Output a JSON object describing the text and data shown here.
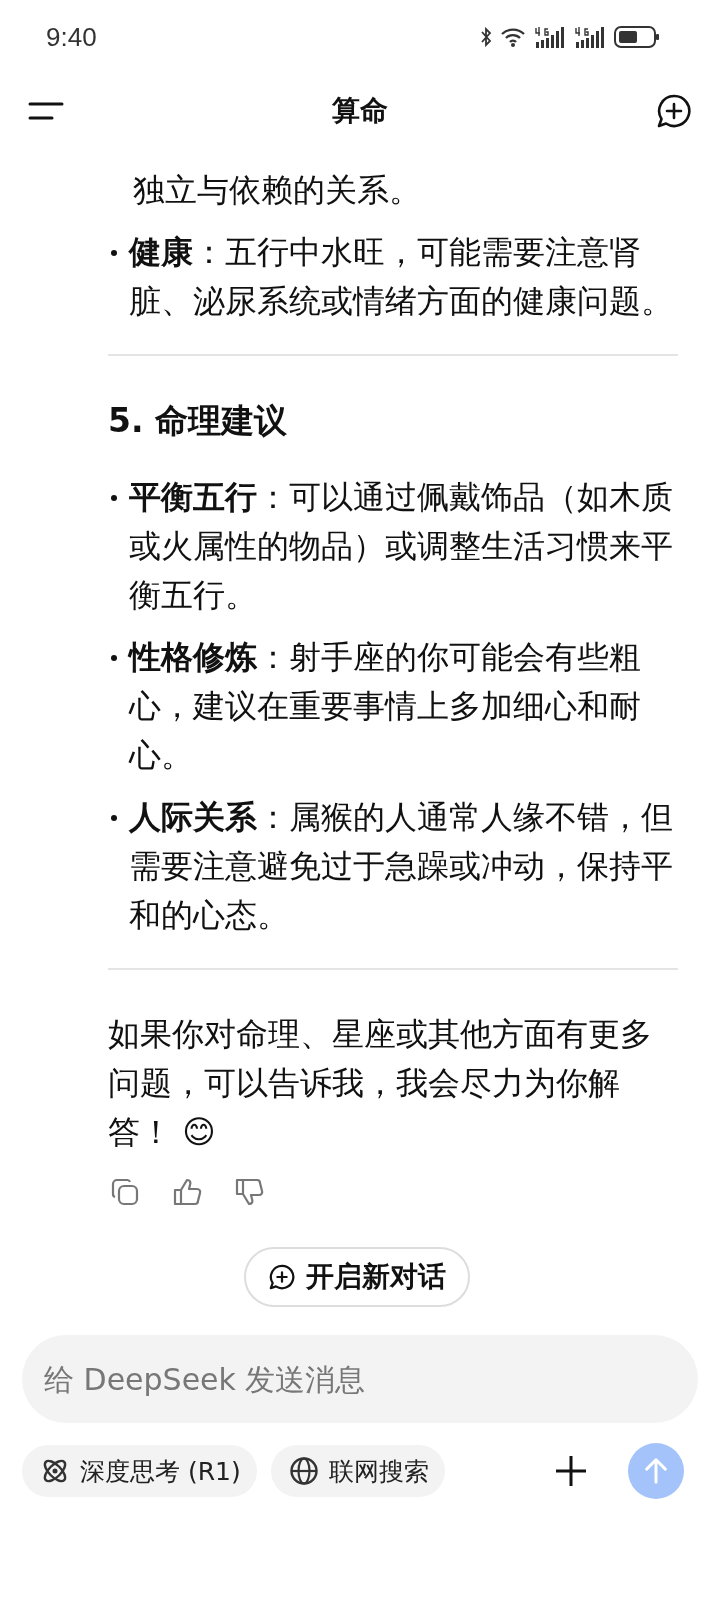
{
  "status_bar": {
    "time": "9:40"
  },
  "header": {
    "title": "算命"
  },
  "sections": [
    {
      "kind": "continuation",
      "text": "独立与依赖的关系。"
    },
    {
      "kind": "bullet",
      "term": "健康",
      "text": "：五行中水旺，可能需要注意肾脏、泌尿系统或情绪方面的健康问题。"
    },
    {
      "kind": "divider"
    },
    {
      "kind": "heading",
      "text": "5. 命理建议"
    },
    {
      "kind": "bullet",
      "term": "平衡五行",
      "text": "：可以通过佩戴饰品（如木质或火属性的物品）或调整生活习惯来平衡五行。"
    },
    {
      "kind": "bullet",
      "term": "性格修炼",
      "text": "：射手座的你可能会有些粗心，建议在重要事情上多加细心和耐心。"
    },
    {
      "kind": "bullet",
      "term": "人际关系",
      "text": "：属猴的人通常人缘不错，但需要注意避免过于急躁或冲动，保持平和的心态。"
    },
    {
      "kind": "divider"
    },
    {
      "kind": "paragraph",
      "text": "如果你对命理、星座或其他方面有更多问题，可以告诉我，我会尽力为你解答！ 😊"
    }
  ],
  "new_chat": {
    "label": "开启新对话"
  },
  "composer": {
    "placeholder": "给 DeepSeek 发送消息"
  },
  "toggles": [
    {
      "kind": "deep",
      "label": "深度思考 (R1)",
      "selected": false
    },
    {
      "kind": "web",
      "label": "联网搜索",
      "selected": false
    }
  ],
  "send": {
    "disabled": true
  }
}
